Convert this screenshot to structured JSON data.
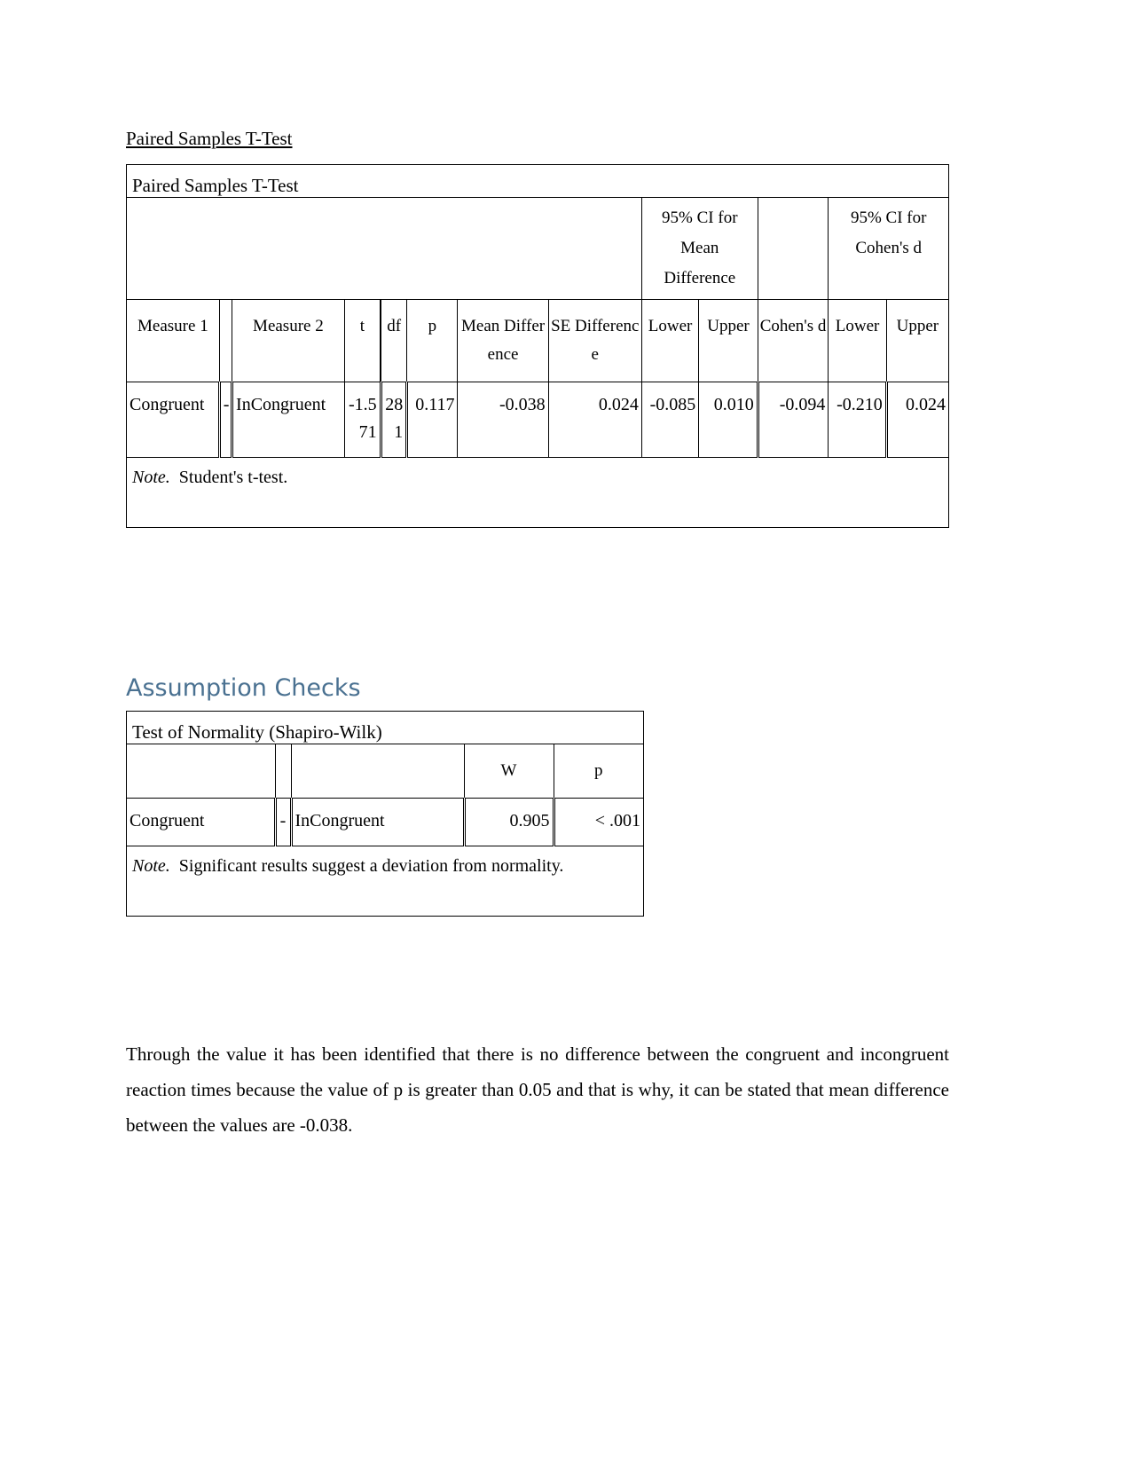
{
  "document": {
    "caption_top": "Paired Samples T-Test",
    "section_heading": "Assumption Checks",
    "accent_color": "#4A7191"
  },
  "ttest_table": {
    "title": "Paired Samples T-Test",
    "spanners": {
      "ci_mean_difference": "95% CI for Mean Difference",
      "ci_cohens_d": "95% CI for Cohen's d"
    },
    "columns": {
      "measure_1": "Measure 1",
      "separator": "",
      "measure_2": "Measure 2",
      "t": "t",
      "df": "df",
      "p": "p",
      "mean_difference": "Mean Difference",
      "se_difference": "SE Difference",
      "ci_md_lower": "Lower",
      "ci_md_upper": "Upper",
      "cohens_d": "Cohen's d",
      "ci_cd_lower": "Lower",
      "ci_cd_upper": "Upper"
    },
    "rows": [
      {
        "measure_1": "Congruent",
        "separator": "-",
        "measure_2": "InCongruent",
        "t": "-1.571",
        "df": "281",
        "p": "0.117",
        "mean_difference": "-0.038",
        "se_difference": "0.024",
        "ci_md_lower": "-0.085",
        "ci_md_upper": "0.010",
        "cohens_d": "-0.094",
        "ci_cd_lower": "-0.210",
        "ci_cd_upper": "0.024"
      }
    ],
    "note_label": "Note.",
    "note_text": "Student's t-test."
  },
  "normality_table": {
    "title": "Test of Normality (Shapiro-Wilk)",
    "columns": {
      "measure_1": "",
      "separator": "",
      "measure_2": "",
      "w": "W",
      "p": "p"
    },
    "rows": [
      {
        "measure_1": "Congruent",
        "separator": "-",
        "measure_2": "InCongruent",
        "w": "0.905",
        "p": "< .001"
      }
    ],
    "note_label": "Note.",
    "note_text": "Significant results suggest a deviation from normality."
  },
  "paragraph": {
    "text": "Through the value it has been identified that there is no difference between the congruent and incongruent reaction times because the value of p is greater than 0.05 and that is why, it can be stated that mean difference between the values are -0.038."
  }
}
